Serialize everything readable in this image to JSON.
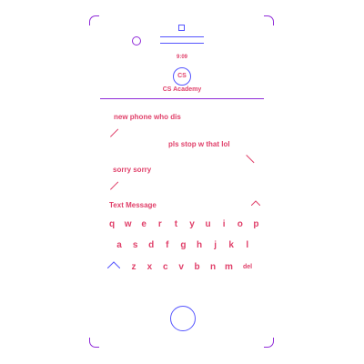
{
  "status": {
    "time": "9:09"
  },
  "header": {
    "logo_text": "CS",
    "contact_name": "CS Academy"
  },
  "messages": [
    {
      "text": "new phone who dis",
      "from": "them"
    },
    {
      "text": "pls stop w that lol",
      "from": "me"
    },
    {
      "text": "sorry sorry",
      "from": "them"
    }
  ],
  "compose": {
    "placeholder": "Text Message"
  },
  "keyboard": {
    "row1": [
      "q",
      "w",
      "e",
      "r",
      "t",
      "y",
      "u",
      "i",
      "o",
      "p"
    ],
    "row2": [
      "a",
      "s",
      "d",
      "f",
      "g",
      "h",
      "j",
      "k",
      "l"
    ],
    "row3": [
      "z",
      "x",
      "c",
      "v",
      "b",
      "n",
      "m"
    ],
    "delete_label": "del"
  },
  "icons": {
    "shift": "shift-chevron-icon",
    "send": "send-chevron-icon",
    "home": "home-button-icon",
    "camera": "camera-icon"
  },
  "colors": {
    "text": "#e0406a",
    "outline_purple": "#8f2ad8",
    "outline_blue": "#5555ff"
  }
}
